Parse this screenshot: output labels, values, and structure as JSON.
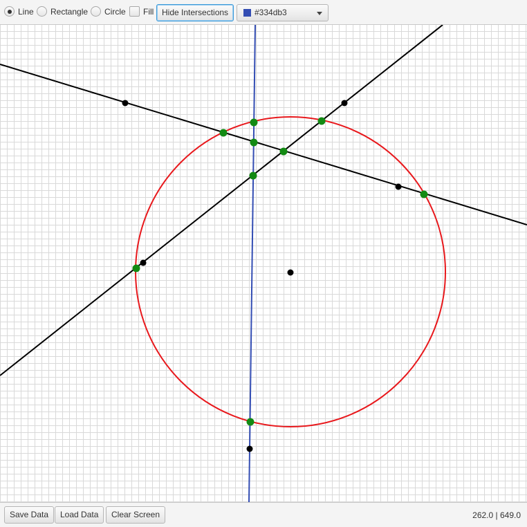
{
  "toolbar": {
    "shape_options": [
      {
        "label": "Line",
        "selected": true
      },
      {
        "label": "Rectangle",
        "selected": false
      },
      {
        "label": "Circle",
        "selected": false
      }
    ],
    "fill_label": "Fill",
    "fill_checked": false,
    "hide_intersections_label": "Hide Intersections",
    "color_value": "#334db3"
  },
  "statusbar": {
    "save_label": "Save Data",
    "load_label": "Load Data",
    "clear_label": "Clear Screen",
    "coordinates": "262.0 | 649.0"
  },
  "canvas": {
    "grid": true,
    "colors": {
      "black_line": "#000000",
      "circle": "#e8181c",
      "blue_line": "#334db3",
      "intersection": "#138a13",
      "control_point": "#000000"
    }
  }
}
